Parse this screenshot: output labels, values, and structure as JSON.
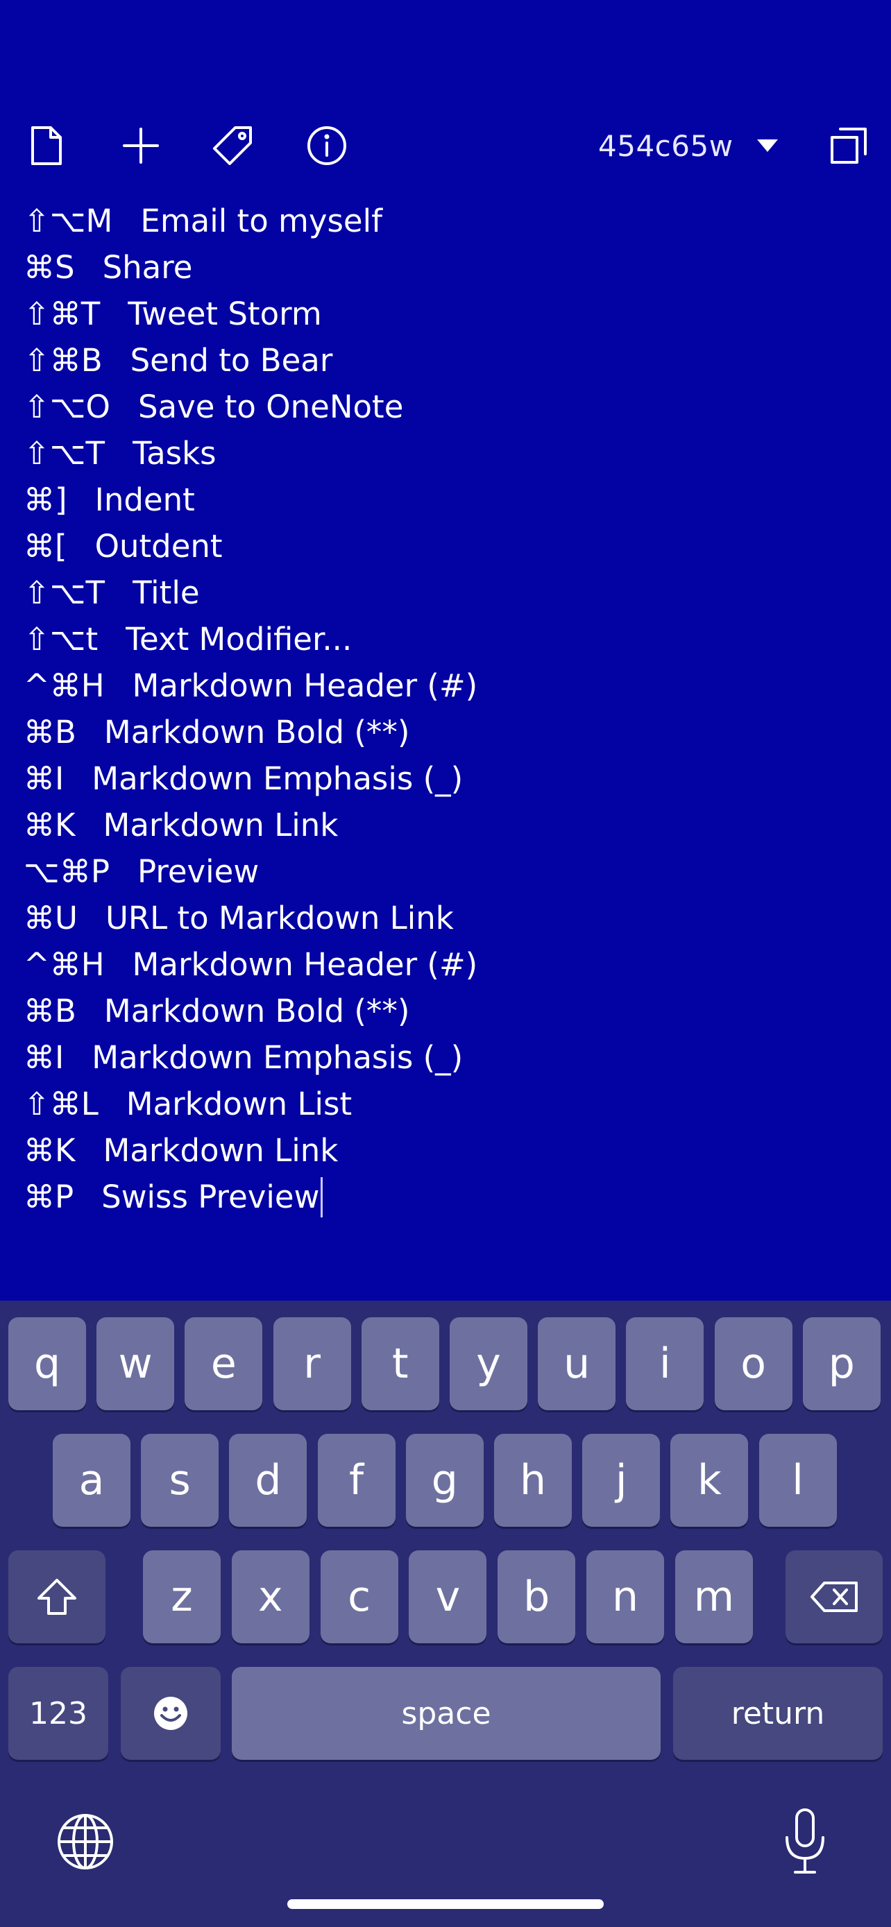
{
  "toolbar": {
    "icons": {
      "document": "document-icon",
      "add": "plus-icon",
      "tag": "tag-icon",
      "info": "info-icon",
      "expand": "expand-icon"
    },
    "note_name": "454c65w"
  },
  "editor": {
    "lines": [
      {
        "shortcut": "⇧⌥M",
        "label": "Email to myself"
      },
      {
        "shortcut": "⌘S",
        "label": "Share"
      },
      {
        "shortcut": "⇧⌘T",
        "label": "Tweet Storm"
      },
      {
        "shortcut": "⇧⌘B",
        "label": "Send to Bear"
      },
      {
        "shortcut": "⇧⌥O",
        "label": "Save to OneNote"
      },
      {
        "shortcut": "⇧⌥T",
        "label": "Tasks"
      },
      {
        "shortcut": "⌘]",
        "label": "Indent"
      },
      {
        "shortcut": "⌘[",
        "label": "Outdent"
      },
      {
        "shortcut": "⇧⌥T",
        "label": "Title"
      },
      {
        "shortcut": "⇧⌥t",
        "label": "Text Modifier..."
      },
      {
        "shortcut": "^⌘H",
        "label": "Markdown Header (#)"
      },
      {
        "shortcut": "⌘B",
        "label": "Markdown Bold (**)"
      },
      {
        "shortcut": "⌘I",
        "label": "Markdown Emphasis (_)"
      },
      {
        "shortcut": "⌘K",
        "label": "Markdown Link"
      },
      {
        "shortcut": "⌥⌘P",
        "label": "Preview"
      },
      {
        "shortcut": "⌘U",
        "label": "URL to Markdown Link"
      },
      {
        "shortcut": "^⌘H",
        "label": "Markdown Header (#)"
      },
      {
        "shortcut": "⌘B",
        "label": "Markdown Bold (**)"
      },
      {
        "shortcut": "⌘I",
        "label": "Markdown Emphasis (_)"
      },
      {
        "shortcut": "⇧⌘L",
        "label": "Markdown List"
      },
      {
        "shortcut": "⌘K",
        "label": "Markdown Link"
      },
      {
        "shortcut": "⌘P",
        "label": "Swiss Preview"
      }
    ]
  },
  "keyboard": {
    "row1": [
      "q",
      "w",
      "e",
      "r",
      "t",
      "y",
      "u",
      "i",
      "o",
      "p"
    ],
    "row2": [
      "a",
      "s",
      "d",
      "f",
      "g",
      "h",
      "j",
      "k",
      "l"
    ],
    "row3": [
      "z",
      "x",
      "c",
      "v",
      "b",
      "n",
      "m"
    ],
    "numbers_label": "123",
    "space_label": "space",
    "return_label": "return",
    "icons": {
      "shift": "shift-icon",
      "delete": "delete-icon",
      "emoji": "emoji-icon",
      "globe": "globe-icon",
      "mic": "microphone-icon"
    }
  },
  "colors": {
    "background": "#0303a3",
    "keyboard_bg": "#2a2b72",
    "key": "#6e719f",
    "function_key": "#46487f"
  }
}
